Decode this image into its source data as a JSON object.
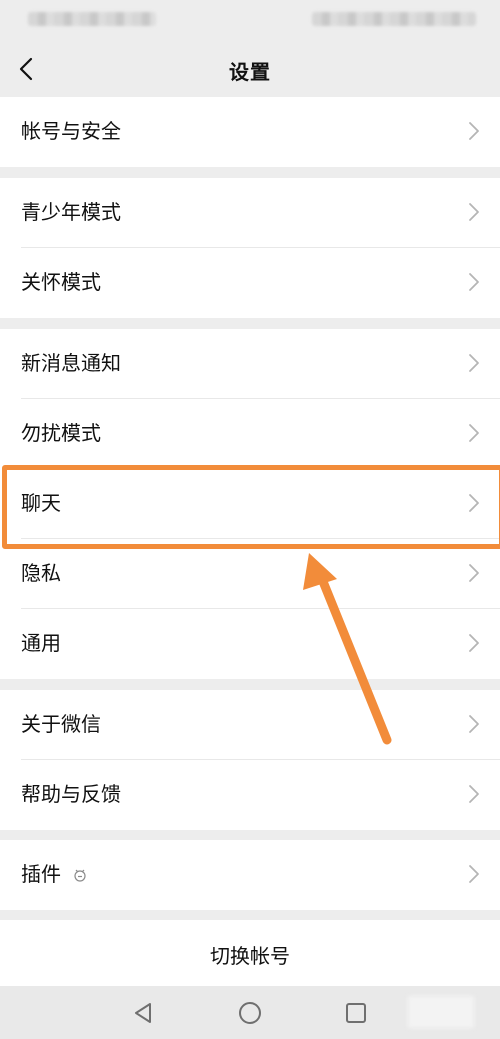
{
  "nav": {
    "title": "设置",
    "back_icon": "chevron-left-icon"
  },
  "groups": [
    {
      "items": [
        {
          "label": "帐号与安全"
        }
      ]
    },
    {
      "items": [
        {
          "label": "青少年模式"
        },
        {
          "label": "关怀模式"
        }
      ]
    },
    {
      "items": [
        {
          "label": "新消息通知"
        },
        {
          "label": "勿扰模式"
        },
        {
          "label": "聊天"
        },
        {
          "label": "隐私"
        },
        {
          "label": "通用"
        }
      ]
    },
    {
      "items": [
        {
          "label": "关于微信"
        },
        {
          "label": "帮助与反馈"
        }
      ]
    },
    {
      "items": [
        {
          "label": "插件",
          "icon": "plugin-icon"
        }
      ]
    }
  ],
  "switch_account": {
    "label": "切换帐号"
  },
  "system_nav": {
    "back": "triangle-back-icon",
    "home": "circle-home-icon",
    "recents": "square-recents-icon"
  },
  "annotation": {
    "highlight_color": "#f28c3a",
    "highlighted_item": "聊天"
  }
}
